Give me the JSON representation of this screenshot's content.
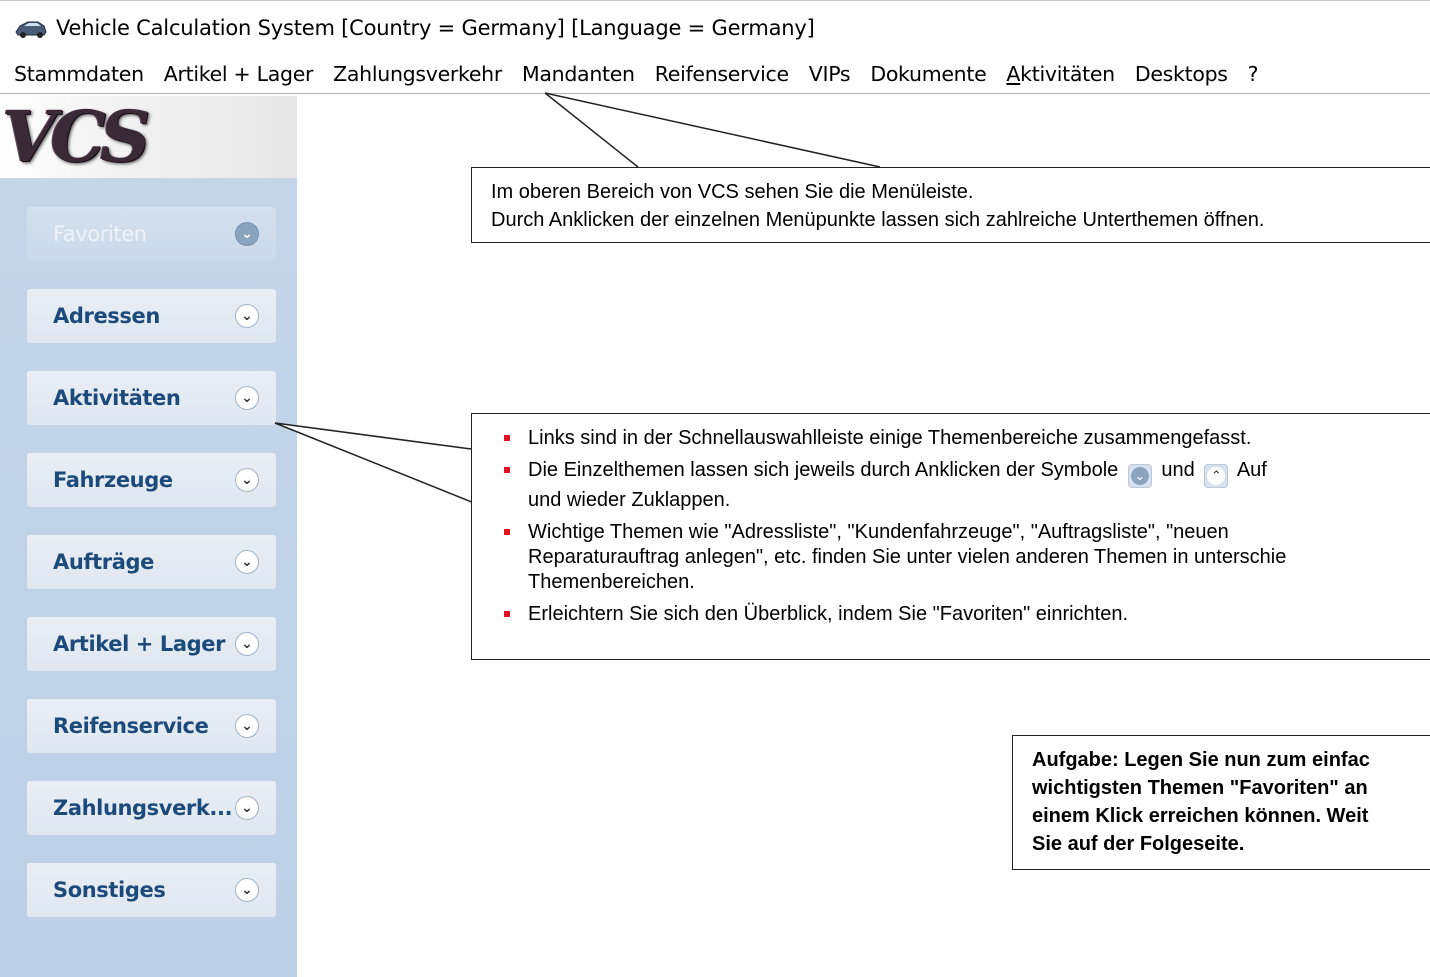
{
  "window": {
    "title": "Vehicle Calculation System [Country = Germany] [Language = Germany]",
    "icon": "car-icon"
  },
  "menubar": {
    "items": [
      {
        "label": "Stammdaten"
      },
      {
        "label": "Artikel + Lager"
      },
      {
        "label": "Zahlungsverkehr"
      },
      {
        "label": "Mandanten"
      },
      {
        "label": "Reifenservice"
      },
      {
        "label": "VIPs"
      },
      {
        "label": "Dokumente"
      },
      {
        "label": "Aktivitäten",
        "mnemonic": "A"
      },
      {
        "label": "Desktops"
      },
      {
        "label": "?"
      }
    ]
  },
  "sidebar": {
    "logo": "VCS",
    "groups": [
      {
        "label": "Favoriten",
        "icon": "double-chevron-down-icon",
        "highlight": true
      },
      {
        "label": "Adressen",
        "icon": "double-chevron-down-icon"
      },
      {
        "label": "Aktivitäten",
        "icon": "double-chevron-down-icon"
      },
      {
        "label": "Fahrzeuge",
        "icon": "double-chevron-down-icon"
      },
      {
        "label": "Aufträge",
        "icon": "double-chevron-down-icon"
      },
      {
        "label": "Artikel + Lager",
        "icon": "double-chevron-down-icon"
      },
      {
        "label": "Reifenservice",
        "icon": "double-chevron-down-icon"
      },
      {
        "label": "Zahlungsverk...",
        "icon": "double-chevron-down-icon"
      },
      {
        "label": "Sonstiges",
        "icon": "double-chevron-down-icon"
      }
    ]
  },
  "callouts": {
    "menu": {
      "line1": "Im oberen Bereich von VCS sehen Sie die Menüleiste.",
      "line2": "Durch Anklicken der einzelnen Menüpunkte lassen sich zahlreiche  Unterthemen öffnen."
    },
    "sidebar": {
      "b1": "Links sind in der Schnellauswahlleiste einige Themenbereiche zusammengefasst.",
      "b2_a": "Die Einzelthemen lassen sich jeweils durch Anklicken der Symbole",
      "b2_and": "und",
      "b2_b": "Auf",
      "b2_c": "und wieder Zuklappen.",
      "b3_a": "Wichtige Themen wie \"Adressliste\", \"Kundenfahrzeuge\", \"Auftragsliste\", \"neuen",
      "b3_b": "Reparaturauftrag anlegen\", etc. finden Sie unter vielen anderen Themen in unterschie",
      "b3_c": "Themenbereichen.",
      "b4": "Erleichtern Sie sich den Überblick, indem Sie \"Favoriten\" einrichten."
    },
    "task": {
      "line1": "Aufgabe: Legen Sie nun zum einfac",
      "line2": "wichtigsten Themen \"Favoriten\" an",
      "line3": "einem Klick erreichen können. Weit",
      "line4": "Sie auf der Folgeseite."
    }
  },
  "colors": {
    "sidebar_bg": "#c3d5e8",
    "group_label": "#1c4a7a",
    "bullet": "#e0141e"
  }
}
